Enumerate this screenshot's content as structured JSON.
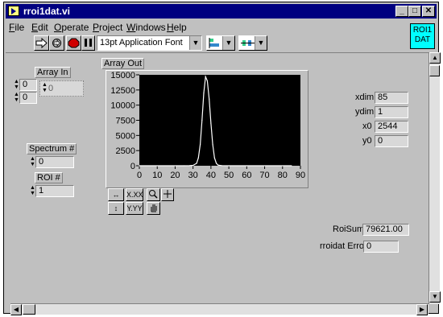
{
  "window": {
    "title": "rroi1dat.vi",
    "controls": {
      "minimize": "_",
      "maximize": "□",
      "close": "✕"
    }
  },
  "menu": [
    {
      "label": "File",
      "key": "F",
      "rest": "ile"
    },
    {
      "label": "Edit",
      "key": "E",
      "rest": "dit"
    },
    {
      "label": "Operate",
      "key": "O",
      "rest": "perate"
    },
    {
      "label": "Project",
      "key": "P",
      "rest": "roject"
    },
    {
      "label": "Windows",
      "key": "W",
      "rest": "indows"
    },
    {
      "label": "Help",
      "key": "H",
      "rest": "elp"
    }
  ],
  "badge": {
    "line1": "ROI1",
    "line2": "DAT"
  },
  "toolbar": {
    "font": "13pt Application Font",
    "icons": [
      "run-arrow-icon",
      "continuous-run-icon",
      "abort-stop-icon",
      "pause-icon",
      "align-icon",
      "distribute-icon"
    ]
  },
  "controls": {
    "array_in": {
      "label": "Array In",
      "index1": "0",
      "index2": "0",
      "value": "0"
    },
    "array_out": {
      "label": "Array Out"
    },
    "spectrum": {
      "label": "Spectrum #",
      "value": "0"
    },
    "roi": {
      "label": "ROI #",
      "value": "1"
    }
  },
  "indicators": [
    {
      "label": "xdim",
      "value": "85"
    },
    {
      "label": "ydim",
      "value": "1"
    },
    {
      "label": "x0",
      "value": "2544"
    },
    {
      "label": "y0",
      "value": "0"
    }
  ],
  "roisum": {
    "label": "RoiSum",
    "value": "79621.00"
  },
  "error": {
    "label": "rroidat Error",
    "value": "0"
  },
  "palette": {
    "x_format": "X.XX",
    "y_format": "Y.YY"
  },
  "chart_data": {
    "type": "line",
    "title": "Array Out",
    "xlim": [
      0,
      90
    ],
    "ylim": [
      0,
      15000
    ],
    "x_ticks": [
      "0",
      "10",
      "20",
      "30",
      "40",
      "50",
      "60",
      "70",
      "80",
      "90"
    ],
    "y_ticks": [
      "0",
      "2500",
      "5000",
      "7500",
      "10000",
      "12500",
      "15000"
    ],
    "background": "#000000",
    "line_color": "#ffffff",
    "series": [
      {
        "x": [
          0,
          25,
          28,
          30,
          32,
          33,
          34,
          35,
          36,
          37,
          38,
          39,
          40,
          41,
          42,
          43,
          44,
          46,
          50,
          60,
          85
        ],
        "y": [
          0,
          0,
          10,
          60,
          400,
          1300,
          3500,
          7500,
          12000,
          14700,
          14000,
          11000,
          7000,
          3500,
          1300,
          400,
          100,
          20,
          0,
          0,
          0
        ]
      }
    ]
  }
}
